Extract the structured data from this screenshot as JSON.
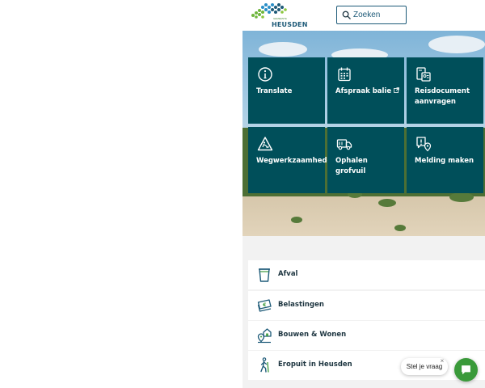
{
  "header": {
    "logo_text": "HEUSDEN",
    "logo_sub": "GEMEENTE",
    "search_placeholder": "Zoeken"
  },
  "tiles": [
    {
      "label": "Translate",
      "icon": "info-icon"
    },
    {
      "label": "Afspraak balie",
      "icon": "calendar-icon",
      "external": true
    },
    {
      "label": "Reisdocument aanvragen",
      "icon": "id-card-icon"
    },
    {
      "label": "Wegwerkzaamheden",
      "icon": "roadwork-icon"
    },
    {
      "label": "Ophalen grofvuil",
      "icon": "truck-icon"
    },
    {
      "label": "Melding maken",
      "icon": "report-location-icon"
    }
  ],
  "list": [
    {
      "label": "Afval",
      "icon": "bin-icon"
    },
    {
      "label": "Belastingen",
      "icon": "money-icon"
    },
    {
      "label": "Bouwen & Wonen",
      "icon": "house-location-icon"
    },
    {
      "label": "Eropuit in Heusden",
      "icon": "hiker-icon"
    }
  ],
  "chat": {
    "prompt": "Stel je vraag",
    "close": "×"
  },
  "colors": {
    "tile": "#004f5a",
    "brand": "#1d5a78",
    "chat": "#3a9a3a"
  }
}
